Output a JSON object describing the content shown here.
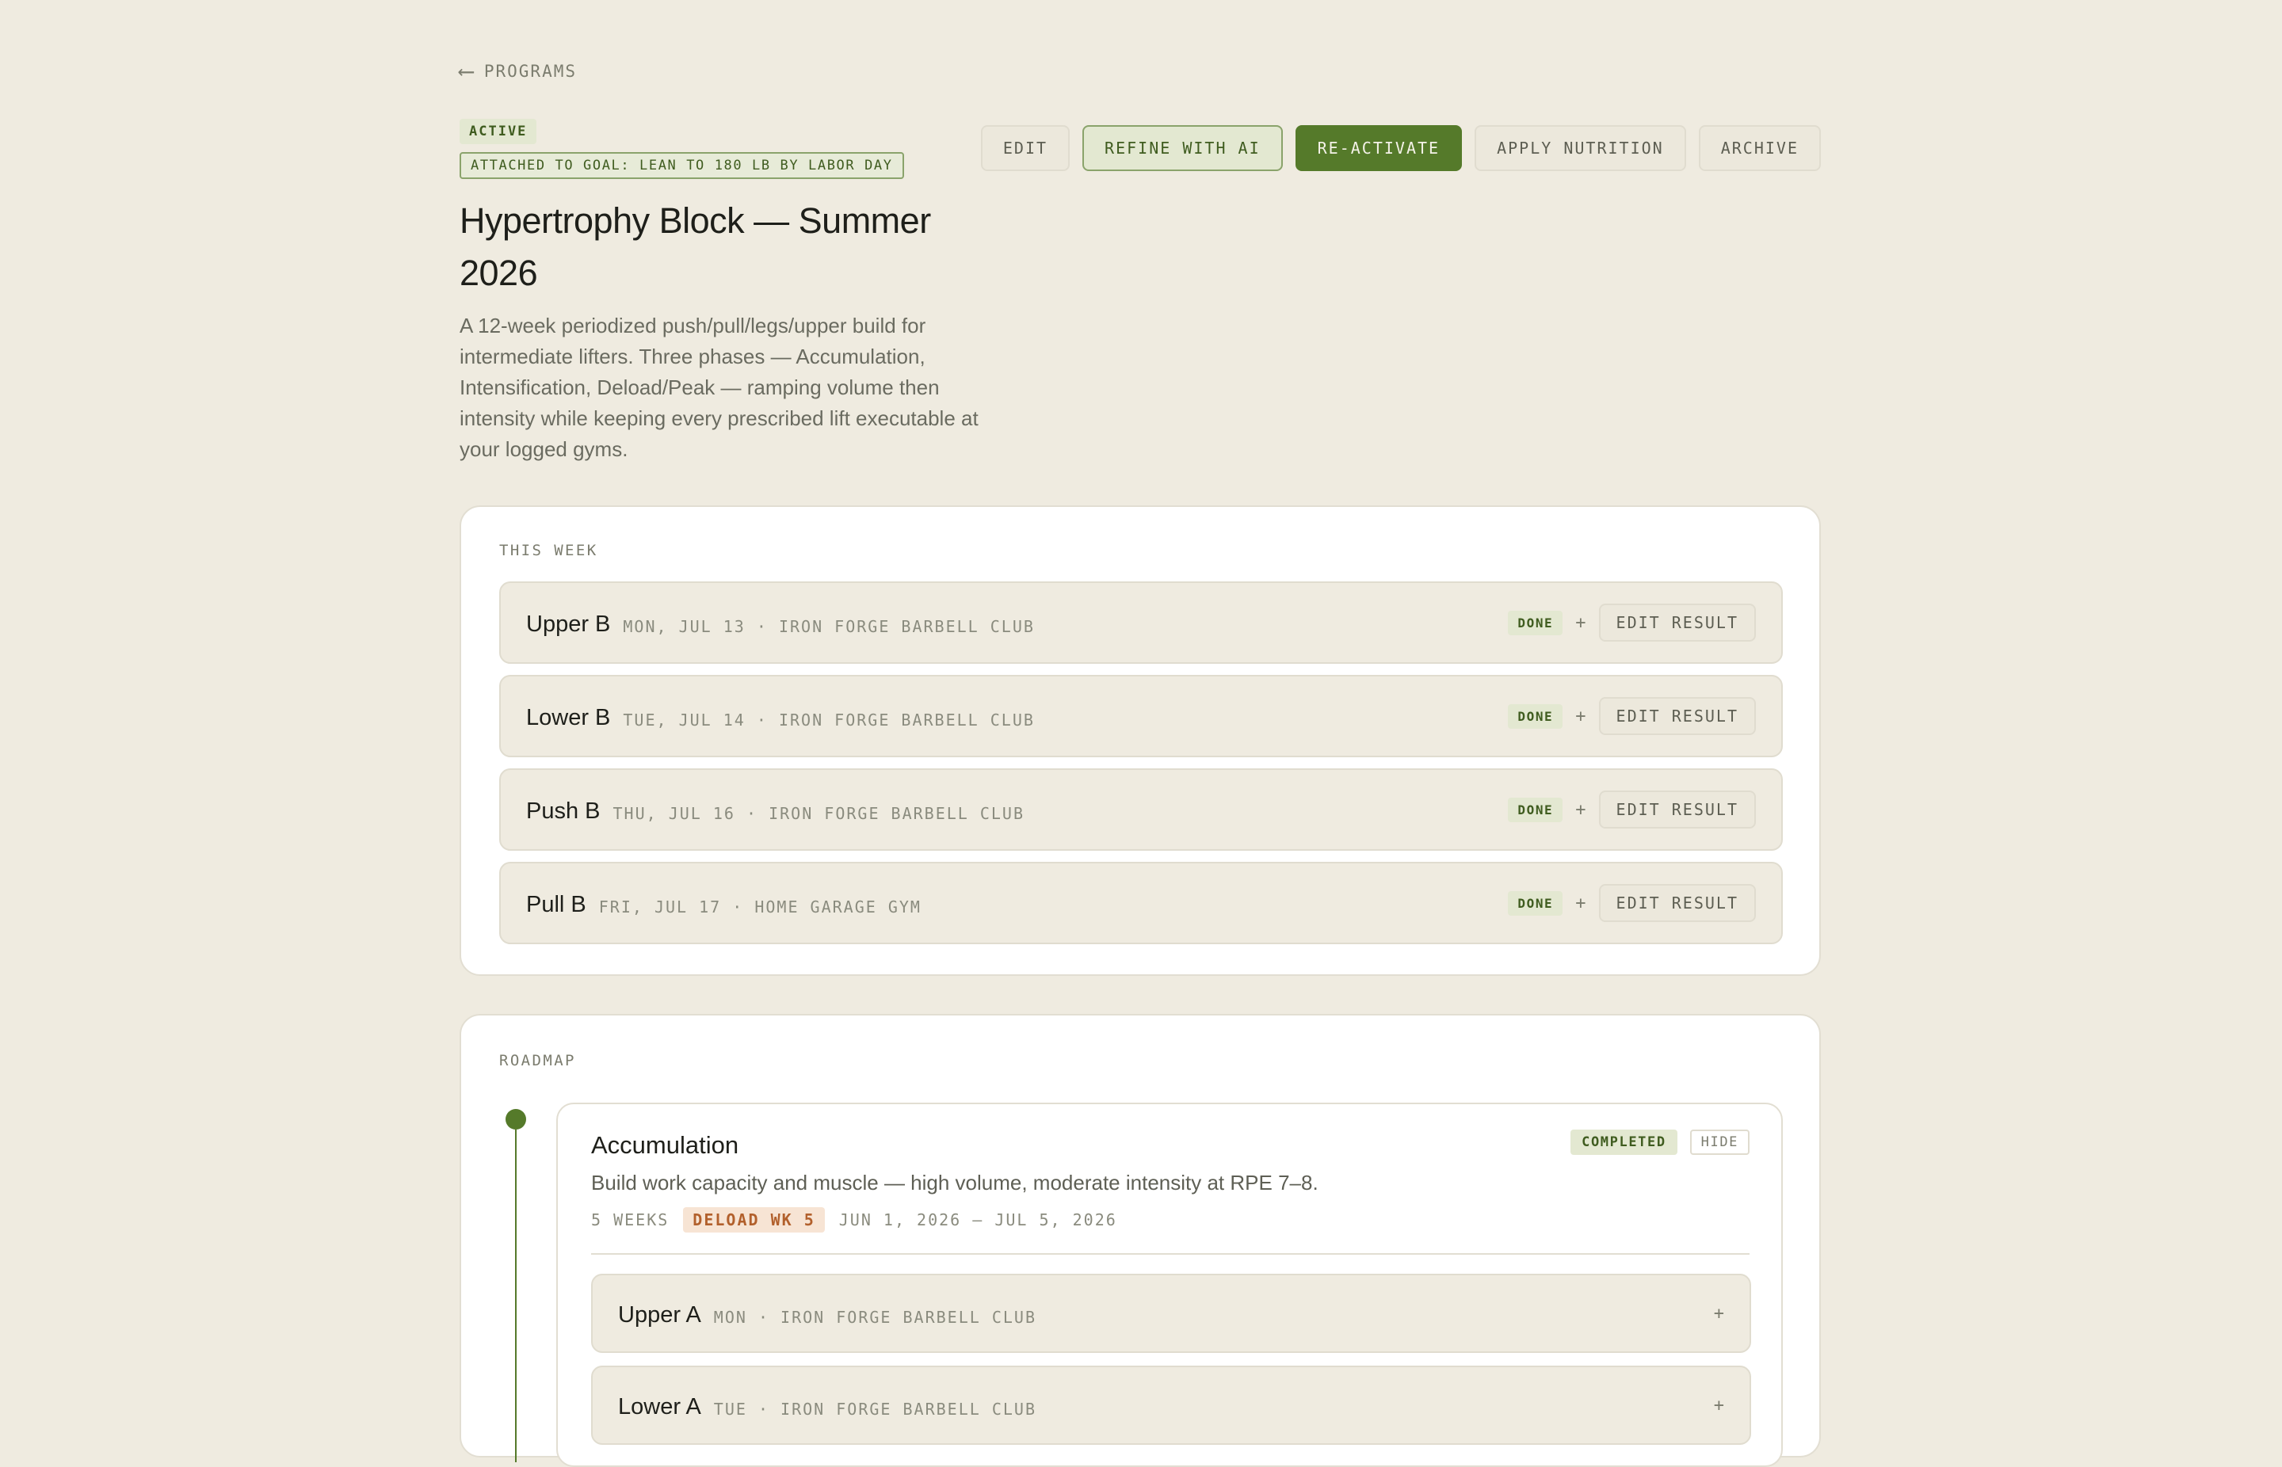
{
  "nav": {
    "back_arrow": "⟵",
    "back_label": "PROGRAMS"
  },
  "program": {
    "status": "ACTIVE",
    "goal": "ATTACHED TO GOAL: LEAN TO 180 LB BY LABOR DAY",
    "title": "Hypertrophy Block — Summer 2026",
    "description": "A 12-week periodized push/pull/legs/upper build for intermediate lifters. Three phases — Accumulation, Intensification, Deload/Peak — ramping volume then intensity while keeping every prescribed lift executable at your logged gyms."
  },
  "actions": {
    "edit": "EDIT",
    "refine": "REFINE WITH AI",
    "reactivate": "RE-ACTIVATE",
    "apply_nutrition": "APPLY NUTRITION",
    "archive": "ARCHIVE"
  },
  "this_week": {
    "label": "THIS WEEK",
    "sessions": [
      {
        "name": "Upper B",
        "meta": "MON, JUL 13 · IRON FORGE BARBELL CLUB",
        "status": "DONE",
        "plus": "+",
        "action": "EDIT RESULT"
      },
      {
        "name": "Lower B",
        "meta": "TUE, JUL 14 · IRON FORGE BARBELL CLUB",
        "status": "DONE",
        "plus": "+",
        "action": "EDIT RESULT"
      },
      {
        "name": "Push B",
        "meta": "THU, JUL 16 · IRON FORGE BARBELL CLUB",
        "status": "DONE",
        "plus": "+",
        "action": "EDIT RESULT"
      },
      {
        "name": "Pull B",
        "meta": "FRI, JUL 17 · HOME GARAGE GYM",
        "status": "DONE",
        "plus": "+",
        "action": "EDIT RESULT"
      }
    ]
  },
  "roadmap": {
    "label": "ROADMAP",
    "phase": {
      "title": "Accumulation",
      "status": "COMPLETED",
      "hide": "HIDE",
      "description": "Build work capacity and muscle — high volume, moderate intensity at RPE 7–8.",
      "weeks": "5 WEEKS",
      "deload": "DELOAD WK 5",
      "dates": "JUN 1, 2026 – JUL 5, 2026",
      "sessions": [
        {
          "name": "Upper A",
          "meta": "MON · IRON FORGE BARBELL CLUB",
          "plus": "+"
        },
        {
          "name": "Lower A",
          "meta": "TUE · IRON FORGE BARBELL CLUB",
          "plus": "+"
        }
      ]
    }
  }
}
